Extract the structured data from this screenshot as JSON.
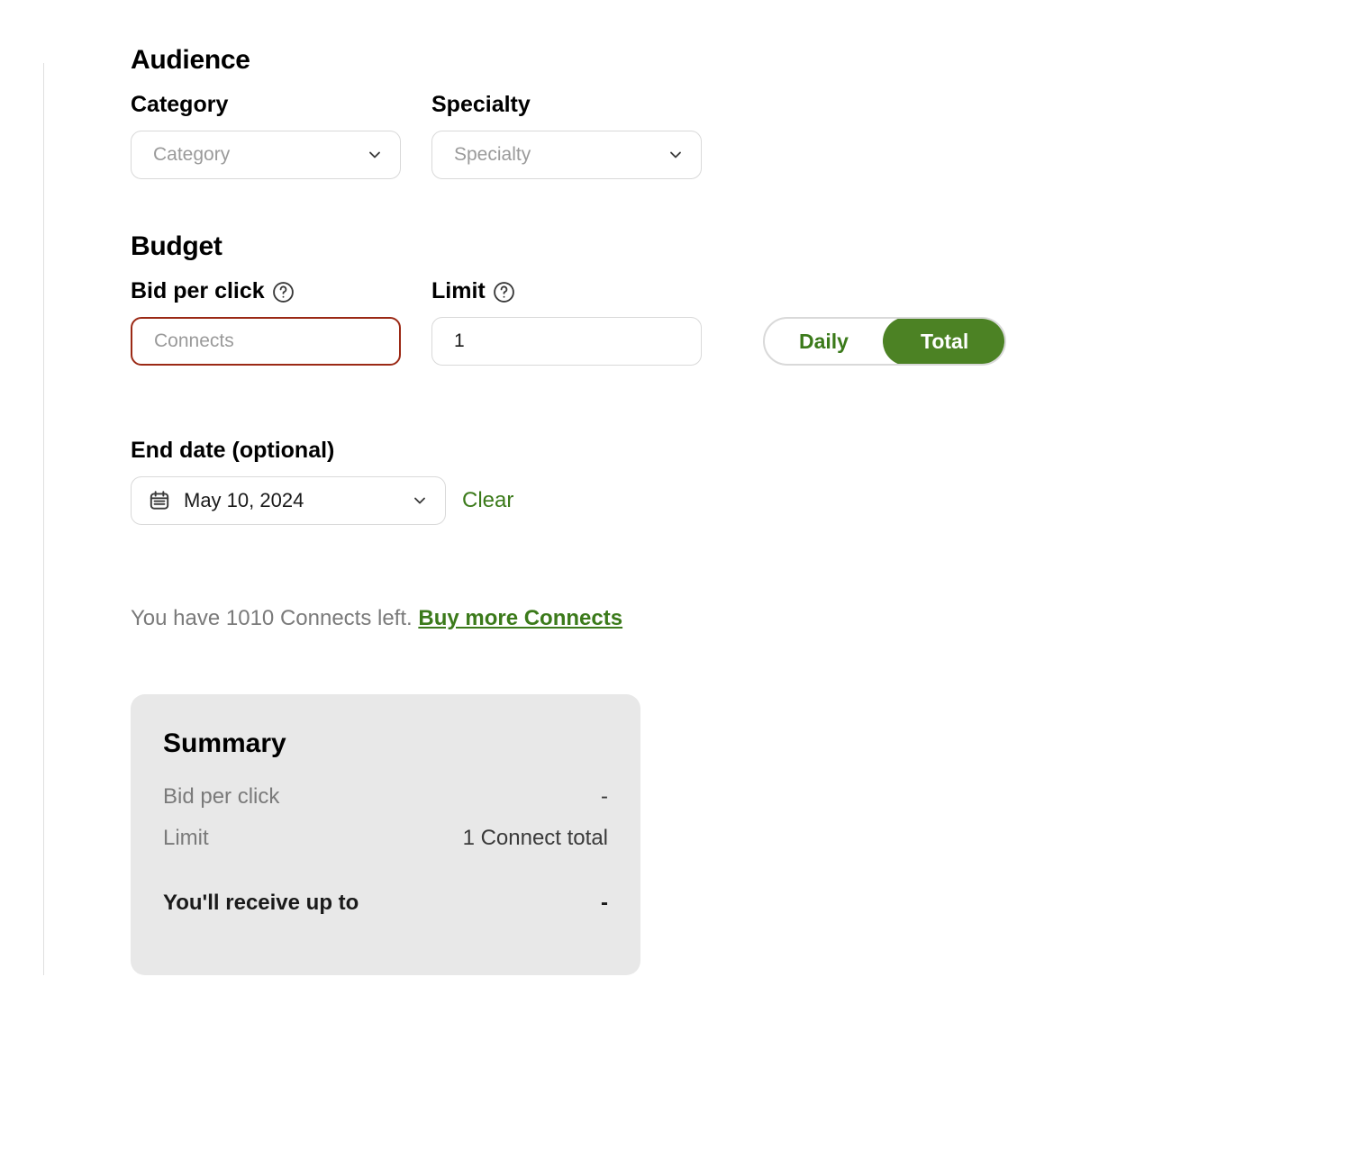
{
  "audience": {
    "title": "Audience",
    "category": {
      "label": "Category",
      "placeholder": "Category"
    },
    "specialty": {
      "label": "Specialty",
      "placeholder": "Specialty"
    }
  },
  "budget": {
    "title": "Budget",
    "bid": {
      "label": "Bid per click",
      "placeholder": "Connects"
    },
    "limit": {
      "label": "Limit",
      "value": "1"
    },
    "toggle": {
      "daily": "Daily",
      "total": "Total"
    }
  },
  "enddate": {
    "label": "End date (optional)",
    "value": "May 10, 2024",
    "clear": "Clear"
  },
  "connects": {
    "line": "You have 1010 Connects left. ",
    "buy": "Buy more Connects"
  },
  "summary": {
    "title": "Summary",
    "rows": [
      {
        "label": "Bid per click",
        "value": "-"
      },
      {
        "label": "Limit",
        "value": "1 Connect total"
      }
    ],
    "receive": {
      "label": "You'll receive up to",
      "value": "-"
    }
  }
}
